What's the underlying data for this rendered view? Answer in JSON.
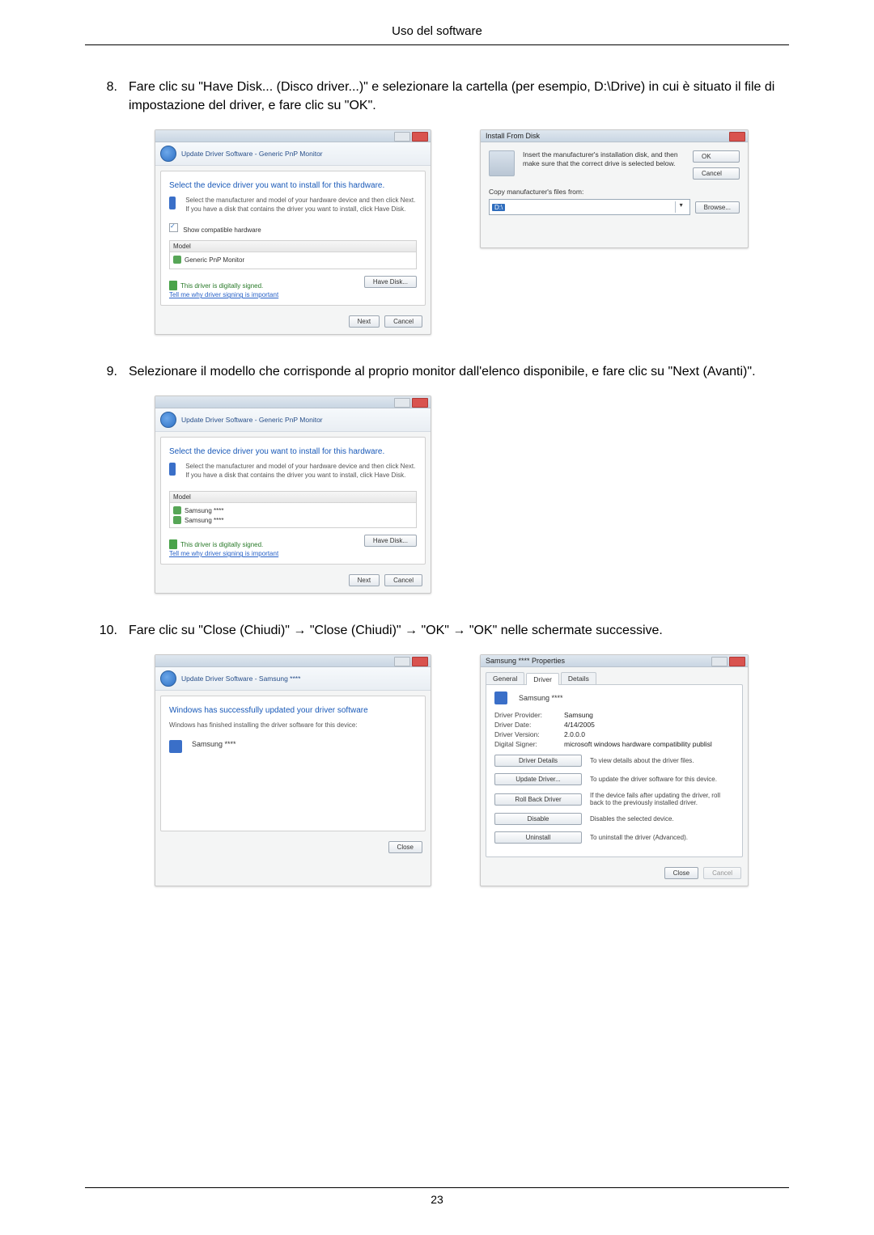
{
  "header": {
    "title": "Uso del software"
  },
  "footer": {
    "page_number": "23"
  },
  "steps": {
    "s8": {
      "num": "8.",
      "text": "Fare clic su \"Have Disk... (Disco driver...)\" e selezionare la cartella (per esempio, D:\\Drive) in cui è situato il file di impostazione del driver, e fare clic su \"OK\"."
    },
    "s9": {
      "num": "9.",
      "text": "Selezionare il modello che corrisponde al proprio monitor dall'elenco disponibile, e fare clic su \"Next (Avanti)\"."
    },
    "s10": {
      "num": "10.",
      "text": "Fare clic su \"Close (Chiudi)\" → \"Close (Chiudi)\" → \"OK\" → \"OK\" nelle schermate successive."
    }
  },
  "dlg_select1": {
    "crumb": "Update Driver Software - Generic PnP Monitor",
    "heading": "Select the device driver you want to install for this hardware.",
    "instr": "Select the manufacturer and model of your hardware device and then click Next. If you have a disk that contains the driver you want to install, click Have Disk.",
    "show_compat": "Show compatible hardware",
    "model_header": "Model",
    "model_item": "Generic PnP Monitor",
    "signed": "This driver is digitally signed.",
    "why_link": "Tell me why driver signing is important",
    "have_disk": "Have Disk...",
    "next": "Next",
    "cancel": "Cancel"
  },
  "dlg_ifd": {
    "title": "Install From Disk",
    "msg": "Insert the manufacturer's installation disk, and then make sure that the correct drive is selected below.",
    "ok": "OK",
    "cancel": "Cancel",
    "copy_label": "Copy manufacturer's files from:",
    "path": "D:\\",
    "browse": "Browse..."
  },
  "dlg_select2": {
    "crumb": "Update Driver Software - Generic PnP Monitor",
    "heading": "Select the device driver you want to install for this hardware.",
    "instr": "Select the manufacturer and model of your hardware device and then click Next. If you have a disk that contains the driver you want to install, click Have Disk.",
    "model_header": "Model",
    "model_item_a": "Samsung ****",
    "model_item_b": "Samsung ****",
    "signed": "This driver is digitally signed.",
    "why_link": "Tell me why driver signing is important",
    "have_disk": "Have Disk...",
    "next": "Next",
    "cancel": "Cancel"
  },
  "dlg_done": {
    "crumb": "Update Driver Software - Samsung ****",
    "heading": "Windows has successfully updated your driver software",
    "sub": "Windows has finished installing the driver software for this device:",
    "device": "Samsung ****",
    "close": "Close"
  },
  "dlg_props": {
    "title": "Samsung **** Properties",
    "tab_general": "General",
    "tab_driver": "Driver",
    "tab_details": "Details",
    "device": "Samsung ****",
    "provider_k": "Driver Provider:",
    "provider_v": "Samsung",
    "date_k": "Driver Date:",
    "date_v": "4/14/2005",
    "version_k": "Driver Version:",
    "version_v": "2.0.0.0",
    "signer_k": "Digital Signer:",
    "signer_v": "microsoft windows hardware compatibility publisl",
    "btn_details": "Driver Details",
    "btn_details_desc": "To view details about the driver files.",
    "btn_update": "Update Driver...",
    "btn_update_desc": "To update the driver software for this device.",
    "btn_rollback": "Roll Back Driver",
    "btn_rollback_desc": "If the device fails after updating the driver, roll back to the previously installed driver.",
    "btn_disable": "Disable",
    "btn_disable_desc": "Disables the selected device.",
    "btn_uninstall": "Uninstall",
    "btn_uninstall_desc": "To uninstall the driver (Advanced).",
    "close": "Close",
    "cancel": "Cancel"
  }
}
